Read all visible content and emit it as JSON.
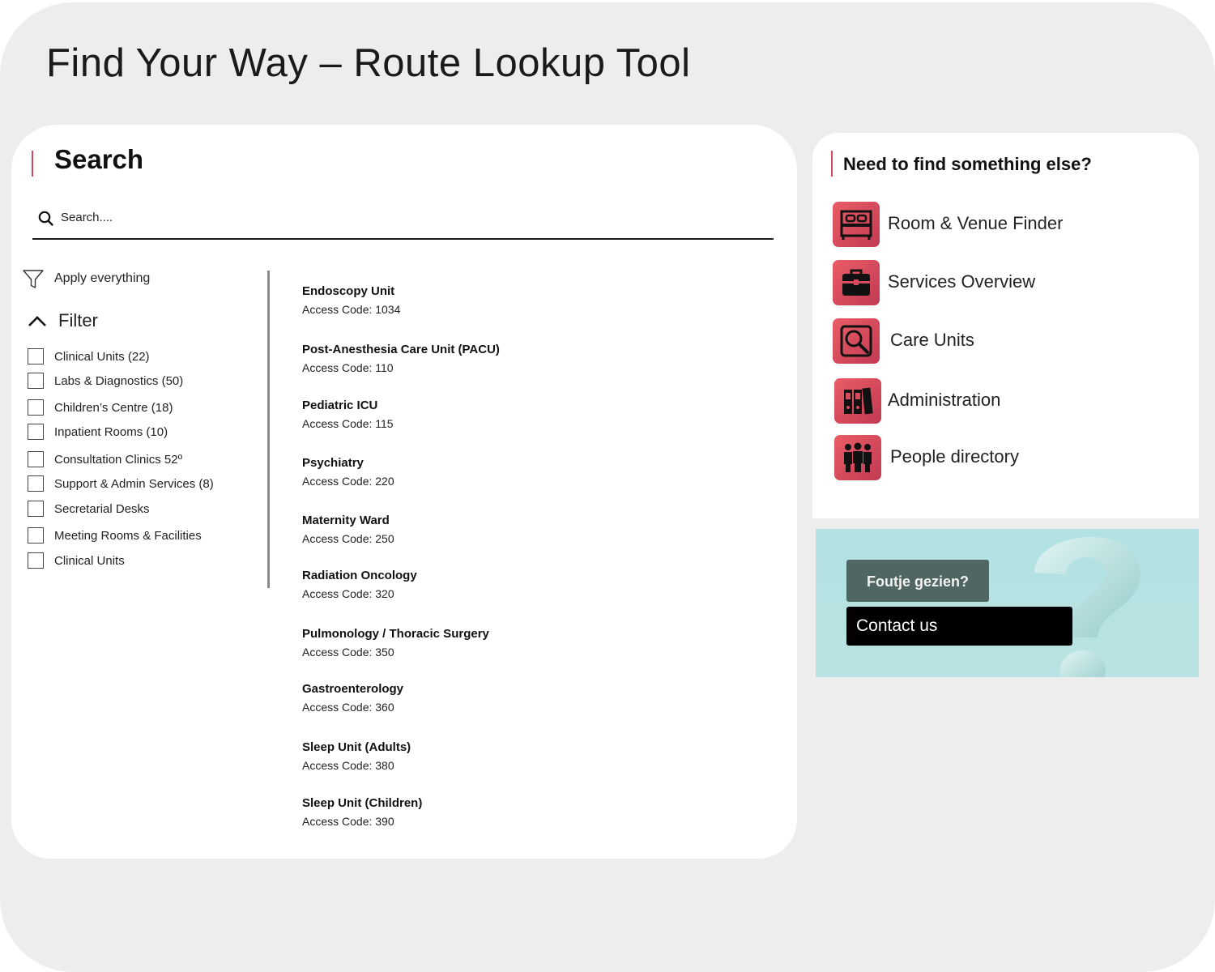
{
  "page": {
    "title": "Find Your Way – Route Lookup Tool"
  },
  "search": {
    "heading": "Search",
    "placeholder": "Search....",
    "value": ""
  },
  "filters": {
    "apply_label": "Apply everything",
    "toggle_label": "Filter",
    "items": [
      {
        "label": "Clinical Units (22)",
        "checked": false
      },
      {
        "label": "Labs & Diagnostics (50)",
        "checked": false
      },
      {
        "label": "Children’s Centre (18)",
        "checked": false
      },
      {
        "label": "Inpatient Rooms (10)",
        "checked": false
      },
      {
        "label": "Consultation Clinics 52º",
        "checked": false
      },
      {
        "label": " Support & Admin Services (8)",
        "checked": false
      },
      {
        "label": "Secretarial Desks",
        "checked": false
      },
      {
        "label": " Meeting Rooms & Facilities",
        "checked": false
      },
      {
        "label": "Clinical Units",
        "checked": false
      }
    ]
  },
  "results": [
    {
      "name": "Endoscopy Unit",
      "code": "Access Code: 1034"
    },
    {
      "name": "Post-Anesthesia Care Unit (PACU)",
      "code": "Access Code: 110"
    },
    {
      "name": "Pediatric ICU",
      "code": "Access Code: 115"
    },
    {
      "name": "Psychiatry",
      "code": "Access Code: 220"
    },
    {
      "name": "Maternity Ward",
      "code": "Access Code: 250"
    },
    {
      "name": "Radiation Oncology",
      "code": "Access Code: 320"
    },
    {
      "name": "Pulmonology / Thoracic Surgery",
      "code": "Access Code: 350"
    },
    {
      "name": "Gastroenterology",
      "code": "Access Code: 360"
    },
    {
      "name": "Sleep Unit (Adults)",
      "code": "Access Code: 380"
    },
    {
      "name": "Sleep Unit (Children)",
      "code": "Access Code: 390"
    }
  ],
  "quick_links": {
    "heading": "Need to find something else?",
    "items": [
      {
        "label": "Room & Venue Finder",
        "icon": "bed-icon"
      },
      {
        "label": "Services Overview",
        "icon": "briefcase-icon"
      },
      {
        "label": "Care Units",
        "icon": "magnifier-icon"
      },
      {
        "label": "Administration",
        "icon": "binders-icon"
      },
      {
        "label": "People directory",
        "icon": "people-icon"
      }
    ]
  },
  "feedback": {
    "prompt": "Foutje gezien?",
    "contact": "Contact us"
  },
  "colors": {
    "accent": "#d34a5c",
    "tile_start": "#ea5d66",
    "tile_end": "#c23a53",
    "banner": "#b2e2e2",
    "feedback_button": "#4f6663"
  }
}
